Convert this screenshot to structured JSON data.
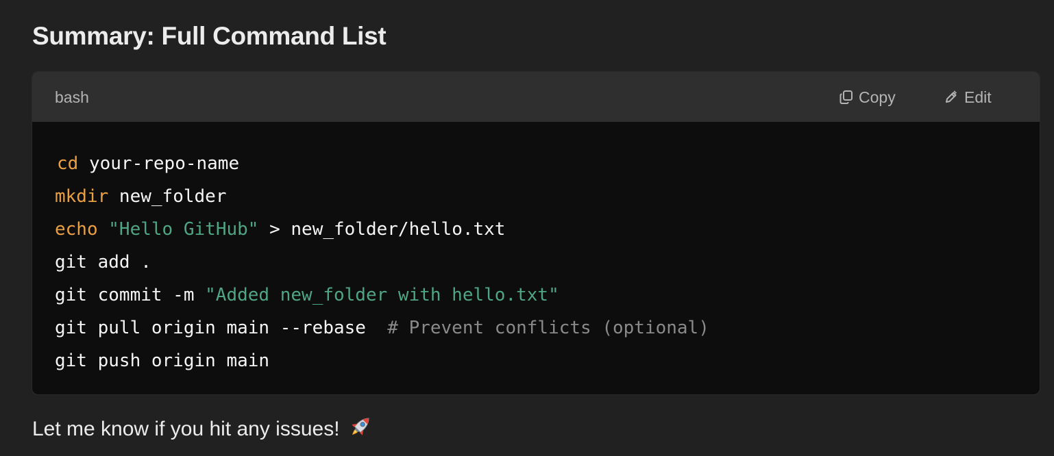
{
  "heading": "Summary: Full Command List",
  "code_block": {
    "language": "bash",
    "copy_label": "Copy",
    "edit_label": "Edit",
    "lines": [
      [
        {
          "t": "cd",
          "c": "kw"
        },
        {
          "t": " your-repo-name",
          "c": "plain"
        }
      ],
      [
        {
          "t": "mkdir",
          "c": "kw"
        },
        {
          "t": " new_folder",
          "c": "plain"
        }
      ],
      [
        {
          "t": "echo",
          "c": "kw"
        },
        {
          "t": " ",
          "c": "plain"
        },
        {
          "t": "\"Hello GitHub\"",
          "c": "str"
        },
        {
          "t": " > new_folder/hello.txt",
          "c": "plain"
        }
      ],
      [
        {
          "t": "git add .",
          "c": "plain"
        }
      ],
      [
        {
          "t": "git commit -m ",
          "c": "plain"
        },
        {
          "t": "\"Added new_folder with hello.txt\"",
          "c": "str"
        }
      ],
      [
        {
          "t": "git pull origin main --rebase  ",
          "c": "plain"
        },
        {
          "t": "# Prevent conflicts (optional)",
          "c": "cmt"
        }
      ],
      [
        {
          "t": "git push origin main",
          "c": "plain"
        }
      ]
    ],
    "colors": {
      "keyword": "#e9a045",
      "string": "#4fa584",
      "comment": "#8a8a8a"
    }
  },
  "footer": {
    "text": "Let me know if you hit any issues!",
    "emoji_icon": "rocket-icon"
  }
}
